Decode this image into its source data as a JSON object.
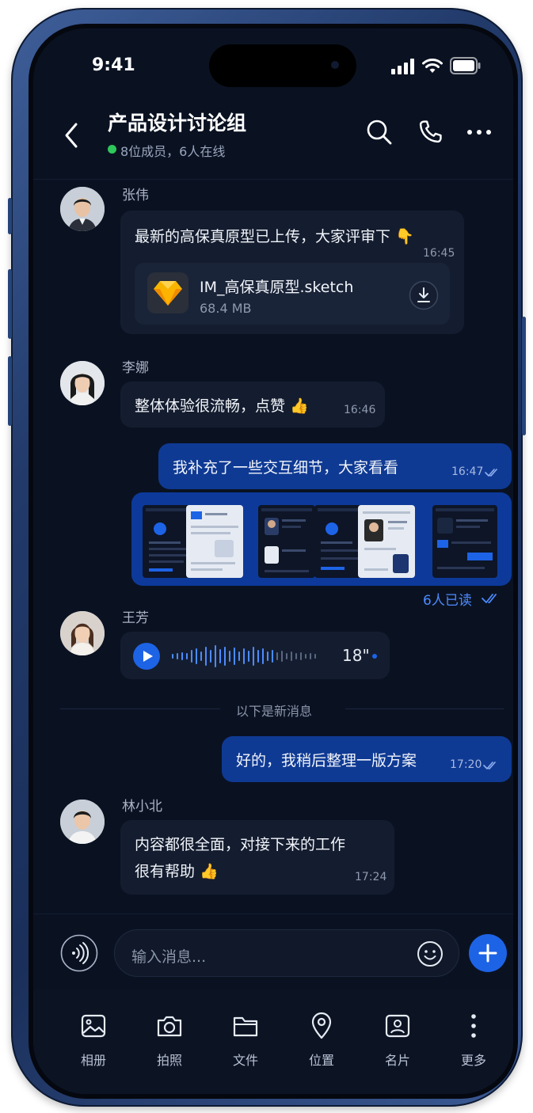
{
  "status": {
    "time": "9:41"
  },
  "header": {
    "title": "产品设计讨论组",
    "subtitle": "8位成员，6人在线"
  },
  "messages": [
    {
      "sender": "张伟",
      "text": "最新的高保真原型已上传，大家评审下 👇",
      "time": "16:45",
      "file": {
        "name": "IM_高保真原型.sketch",
        "size": "68.4 MB"
      }
    },
    {
      "sender": "李娜",
      "text": "整体体验很流畅，点赞 👍",
      "time": "16:46"
    },
    {
      "text": "我补充了一些交互细节，大家看看",
      "time": "16:47",
      "read_status": "6人已读"
    },
    {
      "sender": "王芳",
      "voice_duration": "18\""
    },
    {
      "text": "好的，我稍后整理一版方案",
      "time": "17:20"
    },
    {
      "sender": "林小北",
      "line1": "内容都很全面，对接下来的工作",
      "line2": "很有帮助 👍",
      "time": "17:24"
    }
  ],
  "divider": "以下是新消息",
  "input": {
    "placeholder": "输入消息..."
  },
  "toolbar": [
    {
      "label": "相册",
      "icon": "photo-icon"
    },
    {
      "label": "拍照",
      "icon": "camera-icon"
    },
    {
      "label": "文件",
      "icon": "folder-icon"
    },
    {
      "label": "位置",
      "icon": "location-icon"
    },
    {
      "label": "名片",
      "icon": "contact-card-icon"
    },
    {
      "label": "更多",
      "icon": "more-vertical-icon"
    }
  ],
  "colors": {
    "background": "#0a1222",
    "bubble_incoming": "#141d2f",
    "bubble_outgoing": "#0f3a94",
    "accent": "#1d63e6",
    "online": "#2fc65b"
  }
}
